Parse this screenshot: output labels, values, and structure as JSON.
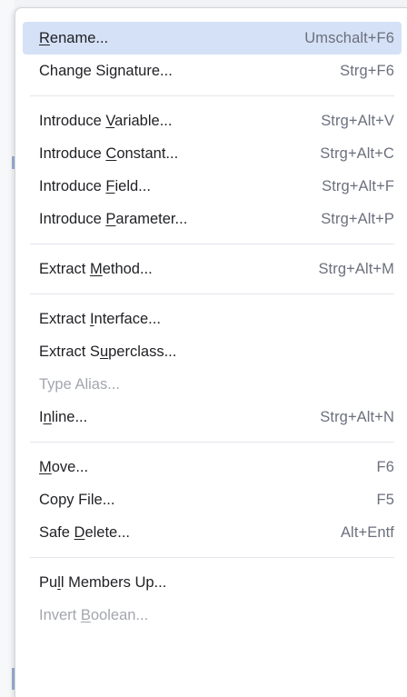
{
  "menu": {
    "groups": [
      {
        "items": [
          {
            "label": "Rename...",
            "mnemonic_index": 0,
            "shortcut": "Umschalt+F6",
            "selected": true,
            "disabled": false,
            "name": "rename"
          },
          {
            "label": "Change Signature...",
            "mnemonic_index": 9,
            "shortcut": "Strg+F6",
            "selected": false,
            "disabled": false,
            "name": "change-signature"
          }
        ]
      },
      {
        "items": [
          {
            "label": "Introduce Variable...",
            "mnemonic_index": 10,
            "shortcut": "Strg+Alt+V",
            "selected": false,
            "disabled": false,
            "name": "introduce-variable"
          },
          {
            "label": "Introduce Constant...",
            "mnemonic_index": 10,
            "shortcut": "Strg+Alt+C",
            "selected": false,
            "disabled": false,
            "name": "introduce-constant"
          },
          {
            "label": "Introduce Field...",
            "mnemonic_index": 10,
            "shortcut": "Strg+Alt+F",
            "selected": false,
            "disabled": false,
            "name": "introduce-field"
          },
          {
            "label": "Introduce Parameter...",
            "mnemonic_index": 10,
            "shortcut": "Strg+Alt+P",
            "selected": false,
            "disabled": false,
            "name": "introduce-parameter"
          }
        ]
      },
      {
        "items": [
          {
            "label": "Extract Method...",
            "mnemonic_index": 8,
            "shortcut": "Strg+Alt+M",
            "selected": false,
            "disabled": false,
            "name": "extract-method"
          }
        ]
      },
      {
        "items": [
          {
            "label": "Extract Interface...",
            "mnemonic_index": 8,
            "shortcut": "",
            "selected": false,
            "disabled": false,
            "name": "extract-interface"
          },
          {
            "label": "Extract Superclass...",
            "mnemonic_index": 9,
            "shortcut": "",
            "selected": false,
            "disabled": false,
            "name": "extract-superclass"
          },
          {
            "label": "Type Alias...",
            "mnemonic_index": -1,
            "shortcut": "",
            "selected": false,
            "disabled": true,
            "name": "type-alias"
          },
          {
            "label": "Inline...",
            "mnemonic_index": 1,
            "shortcut": "Strg+Alt+N",
            "selected": false,
            "disabled": false,
            "name": "inline"
          }
        ]
      },
      {
        "items": [
          {
            "label": "Move...",
            "mnemonic_index": 0,
            "shortcut": "F6",
            "selected": false,
            "disabled": false,
            "name": "move"
          },
          {
            "label": "Copy File...",
            "mnemonic_index": -1,
            "shortcut": "F5",
            "selected": false,
            "disabled": false,
            "name": "copy-file"
          },
          {
            "label": "Safe Delete...",
            "mnemonic_index": 5,
            "shortcut": "Alt+Entf",
            "selected": false,
            "disabled": false,
            "name": "safe-delete"
          }
        ]
      },
      {
        "items": [
          {
            "label": "Pull Members Up...",
            "mnemonic_index": 2,
            "shortcut": "",
            "selected": false,
            "disabled": false,
            "name": "pull-members-up"
          },
          {
            "label": "Invert Boolean...",
            "mnemonic_index": 7,
            "shortcut": "",
            "selected": false,
            "disabled": true,
            "name": "invert-boolean"
          }
        ]
      }
    ]
  },
  "colors": {
    "selection_bg": "#d5e1f6",
    "text": "#1f2024",
    "shortcut": "#6c707e",
    "disabled": "#a3a6ad"
  }
}
